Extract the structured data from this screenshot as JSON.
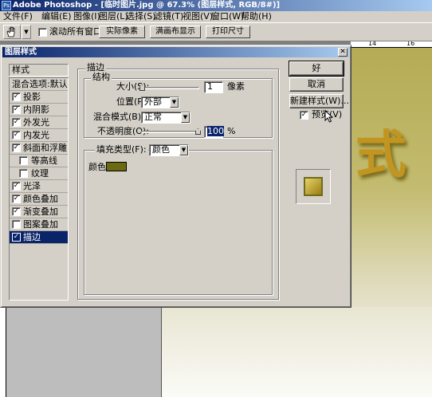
{
  "app": {
    "title": "Adobe Photoshop - [临时图片.jpg @ 67.3% (图层样式, RGB/8#)]",
    "icon": "photoshop-icon"
  },
  "menu": [
    {
      "label": "文件(F)"
    },
    {
      "label": "编辑(E)"
    },
    {
      "label": "图像(I)"
    },
    {
      "label": "图层(L)"
    },
    {
      "label": "选择(S)"
    },
    {
      "label": "滤镜(T)"
    },
    {
      "label": "视图(V)"
    },
    {
      "label": "窗口(W)"
    },
    {
      "label": "帮助(H)"
    }
  ],
  "options_bar": {
    "tool_icon": "hand-icon",
    "scroll_all_label": "滚动所有窗口",
    "scroll_all_checked": false,
    "actual_pixels": "实际像素",
    "fit_screen": "满画布显示",
    "print_size": "打印尺寸"
  },
  "ruler": {
    "tick_14": "14",
    "tick_16": "16"
  },
  "dialog": {
    "title": "图层样式",
    "styles_header": "样式",
    "styles": [
      {
        "label": "混合选项:默认",
        "checkbox": false,
        "checked": false,
        "indent": false,
        "selected": false
      },
      {
        "label": "投影",
        "checkbox": true,
        "checked": true,
        "indent": false,
        "selected": false
      },
      {
        "label": "内阴影",
        "checkbox": true,
        "checked": true,
        "indent": false,
        "selected": false
      },
      {
        "label": "外发光",
        "checkbox": true,
        "checked": true,
        "indent": false,
        "selected": false
      },
      {
        "label": "内发光",
        "checkbox": true,
        "checked": true,
        "indent": false,
        "selected": false
      },
      {
        "label": "斜面和浮雕",
        "checkbox": true,
        "checked": true,
        "indent": false,
        "selected": false
      },
      {
        "label": "等高线",
        "checkbox": true,
        "checked": false,
        "indent": true,
        "selected": false
      },
      {
        "label": "纹理",
        "checkbox": true,
        "checked": false,
        "indent": true,
        "selected": false
      },
      {
        "label": "光泽",
        "checkbox": true,
        "checked": true,
        "indent": false,
        "selected": false
      },
      {
        "label": "颜色叠加",
        "checkbox": true,
        "checked": true,
        "indent": false,
        "selected": false
      },
      {
        "label": "渐变叠加",
        "checkbox": true,
        "checked": true,
        "indent": false,
        "selected": false
      },
      {
        "label": "图案叠加",
        "checkbox": true,
        "checked": false,
        "indent": false,
        "selected": false
      },
      {
        "label": "描边",
        "checkbox": true,
        "checked": true,
        "indent": false,
        "selected": true
      }
    ],
    "stroke": {
      "group_label": "描边",
      "structure_label": "结构",
      "size_label": "大小(S):",
      "size_value": "1",
      "size_unit": "像素",
      "position_label": "位置(P):",
      "position_value": "外部",
      "blend_label": "混合模式(B):",
      "blend_value": "正常",
      "opacity_label": "不透明度(O):",
      "opacity_value": "100",
      "opacity_unit": "%",
      "fill_type_label": "填充类型(F):",
      "fill_type_value": "颜色",
      "color_label": "颜色:",
      "color": "#6b6a12"
    },
    "buttons": {
      "ok": "好",
      "cancel": "取消",
      "new_style": "新建样式(W)...",
      "preview_label": "预览(V)",
      "preview_checked": true
    }
  },
  "artwork": {
    "glyph": "式"
  },
  "colors": {
    "titlebar": "#0a246a",
    "selection": "#0a246a",
    "face": "#d4d0c8"
  }
}
